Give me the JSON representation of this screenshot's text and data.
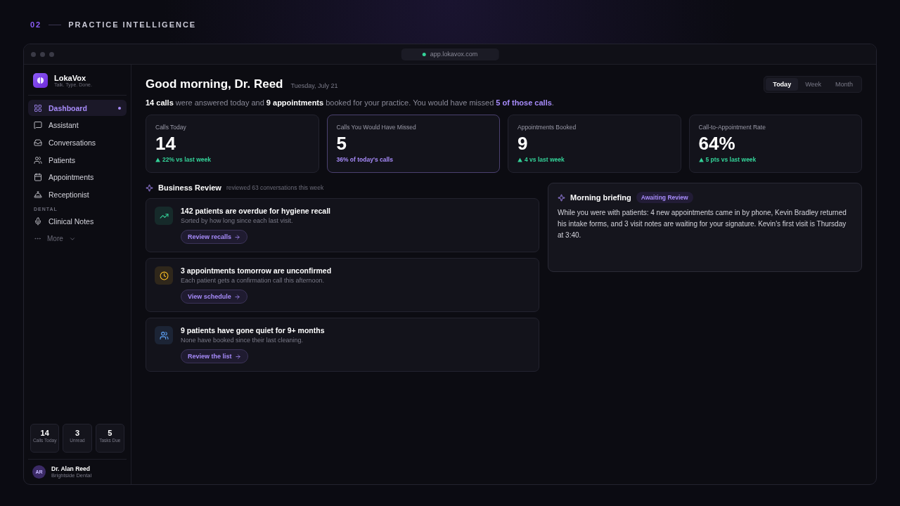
{
  "section": {
    "number": "02",
    "title": "PRACTICE INTELLIGENCE"
  },
  "browser": {
    "url": "app.lokavox.com"
  },
  "brand": {
    "name": "LokaVox",
    "tagline": "Talk. Type. Done."
  },
  "nav": [
    {
      "label": "Dashboard",
      "selected": true
    },
    {
      "label": "Assistant",
      "selected": false
    },
    {
      "label": "Conversations",
      "selected": false
    },
    {
      "label": "Patients",
      "selected": false
    },
    {
      "label": "Appointments",
      "selected": false
    },
    {
      "label": "Receptionist",
      "selected": false
    }
  ],
  "nav_group": {
    "title": "DENTAL",
    "items": [
      {
        "label": "Clinical Notes",
        "selected": false
      }
    ]
  },
  "more": "More",
  "mini_stats": [
    {
      "value": "14",
      "label": "Calls Today"
    },
    {
      "value": "3",
      "label": "Unread"
    },
    {
      "value": "5",
      "label": "Tasks Due"
    }
  ],
  "user": {
    "initials": "AR",
    "name": "Dr. Alan Reed",
    "practice": "Brightside Dental"
  },
  "greeting": "Good morning, Dr. Reed",
  "date": "Tuesday, July 21",
  "range_tabs": [
    {
      "label": "Today",
      "selected": true
    },
    {
      "label": "Week",
      "selected": false
    },
    {
      "label": "Month",
      "selected": false
    }
  ],
  "summary": [
    {
      "kind": "strong",
      "text": "14 calls"
    },
    {
      "kind": "plain",
      "text": " were answered today and "
    },
    {
      "kind": "strong",
      "text": "9 appointments"
    },
    {
      "kind": "plain",
      "text": " booked for your practice. You would have missed "
    },
    {
      "kind": "accent",
      "text": "5 of those calls"
    },
    {
      "kind": "plain",
      "text": "."
    }
  ],
  "stats": [
    {
      "label": "Calls Today",
      "value": "14",
      "delta": "22% vs last week",
      "kind": "up",
      "highlighted": false
    },
    {
      "label": "Calls You Would Have Missed",
      "value": "5",
      "delta": "36% of today's calls",
      "kind": "share",
      "highlighted": true
    },
    {
      "label": "Appointments Booked",
      "value": "9",
      "delta": "4 vs last week",
      "kind": "up",
      "highlighted": false
    },
    {
      "label": "Call-to-Appointment Rate",
      "value": "64%",
      "delta": "5 pts vs last week",
      "kind": "up",
      "highlighted": false
    }
  ],
  "review": {
    "title": "Business Review",
    "note": "reviewed 63 conversations this week",
    "items": [
      {
        "title": "142 patients are overdue for hygiene recall",
        "detail": "Sorted by how long since each last visit.",
        "action": "Review recalls",
        "kind": "growth"
      },
      {
        "title": "3 appointments tomorrow are unconfirmed",
        "detail": "Each patient gets a confirmation call this afternoon.",
        "action": "View schedule",
        "kind": "pending"
      },
      {
        "title": "9 patients have gone quiet for 9+ months",
        "detail": "None have booked since their last cleaning.",
        "action": "Review the list",
        "kind": "people"
      }
    ]
  },
  "briefing": {
    "title": "Morning briefing",
    "badge": "Awaiting Review",
    "text": "While you were with patients: 4 new appointments came in by phone, Kevin Bradley returned his intake forms, and 3 visit notes are waiting for your signature. Kevin's first visit is Thursday at 3:40."
  }
}
